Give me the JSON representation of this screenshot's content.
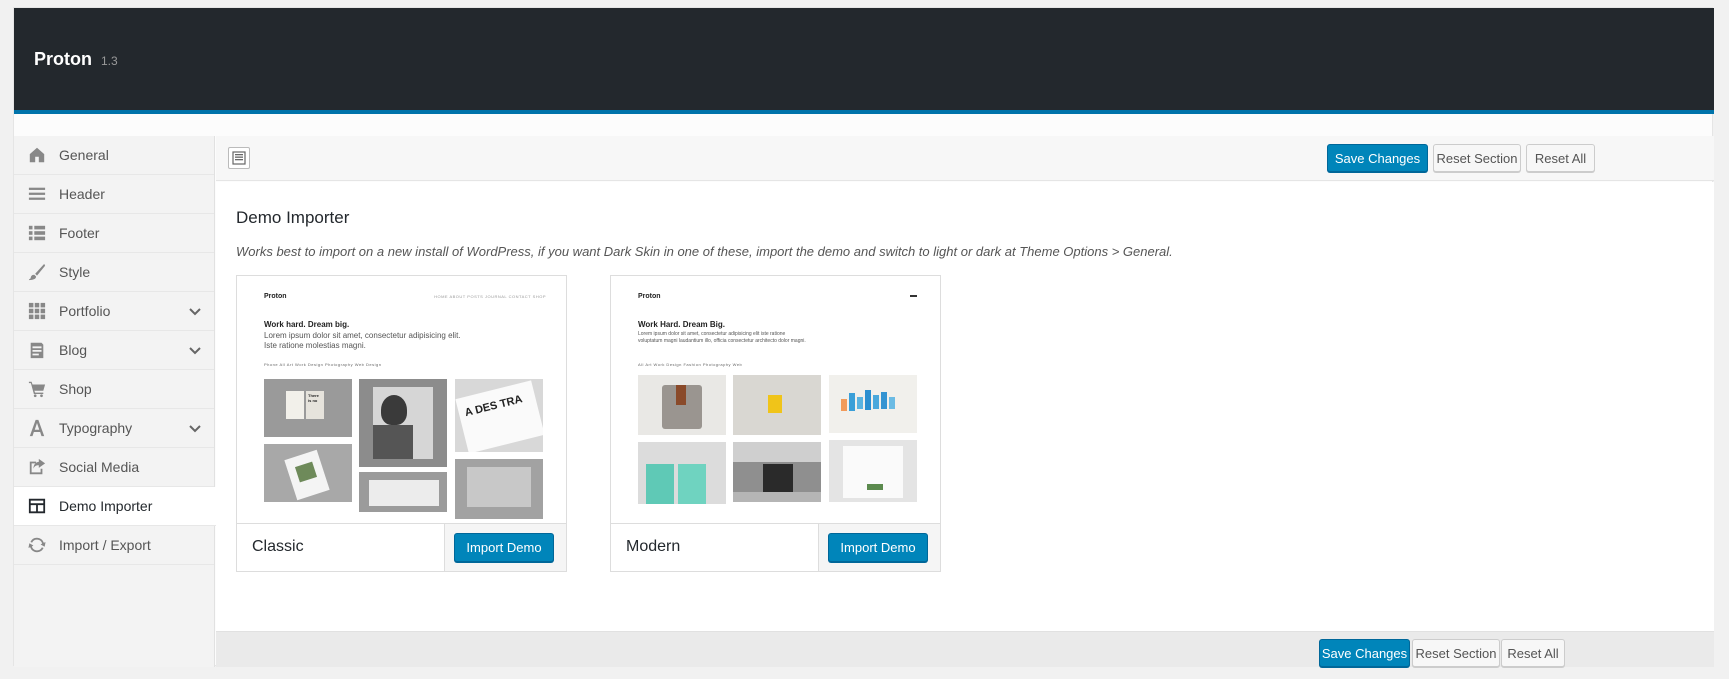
{
  "app": {
    "name": "Proton",
    "version": "1.3"
  },
  "sidebar": {
    "items": [
      {
        "label": "General",
        "icon": "home-icon",
        "has_children": false
      },
      {
        "label": "Header",
        "icon": "menu-icon",
        "has_children": false
      },
      {
        "label": "Footer",
        "icon": "list-icon",
        "has_children": false
      },
      {
        "label": "Style",
        "icon": "brush-icon",
        "has_children": false
      },
      {
        "label": "Portfolio",
        "icon": "grid-icon",
        "has_children": true
      },
      {
        "label": "Blog",
        "icon": "post-icon",
        "has_children": true
      },
      {
        "label": "Shop",
        "icon": "cart-icon",
        "has_children": false
      },
      {
        "label": "Typography",
        "icon": "typography-icon",
        "has_children": true
      },
      {
        "label": "Social Media",
        "icon": "share-icon",
        "has_children": false
      },
      {
        "label": "Demo Importer",
        "icon": "layout-icon",
        "has_children": false,
        "active": true
      },
      {
        "label": "Import / Export",
        "icon": "refresh-icon",
        "has_children": false
      }
    ]
  },
  "toolbar": {
    "save_label": "Save Changes",
    "reset_section_label": "Reset Section",
    "reset_all_label": "Reset All"
  },
  "section": {
    "title": "Demo Importer",
    "description": "Works best to import on a new install of WordPress, if you want Dark Skin in one of these, import the demo and switch to light or dark at Theme Options > General."
  },
  "demos": [
    {
      "name": "Classic",
      "button_label": "Import Demo",
      "preview": {
        "brand": "Proton",
        "menu": "HOME   ABOUT   POSTS   JOURNAL   CONTACT   SHOP",
        "headline": "Work hard. Dream big.",
        "sub_line1": "Lorem ipsum dolor sit amet, consectetur adipisicing elit.",
        "sub_line2": "Iste ratione molestias magni.",
        "filters": "Phone     All     Art Work     Design     Photography     Web Design",
        "poster_text_1": "There is no",
        "poster_text_2": "A DES TRA"
      }
    },
    {
      "name": "Modern",
      "button_label": "Import Demo",
      "preview": {
        "brand": "Proton",
        "headline": "Work Hard. Dream Big.",
        "sub_line1": "Lorem ipsum dolor sit amet, consectetur adipisicing elit iste ratione",
        "sub_line2": "voluptatum magni laudantium illo, officia consectetur architecto dolor magni.",
        "filters": "All     Art Work     Design     Fashion     Photography     Web"
      }
    }
  ],
  "footer": {
    "save_label": "Save Changes",
    "reset_section_label": "Reset Section",
    "reset_all_label": "Reset All"
  },
  "colors": {
    "topbar": "#23282d",
    "accent": "#0073aa",
    "button_primary": "#0085ba"
  }
}
